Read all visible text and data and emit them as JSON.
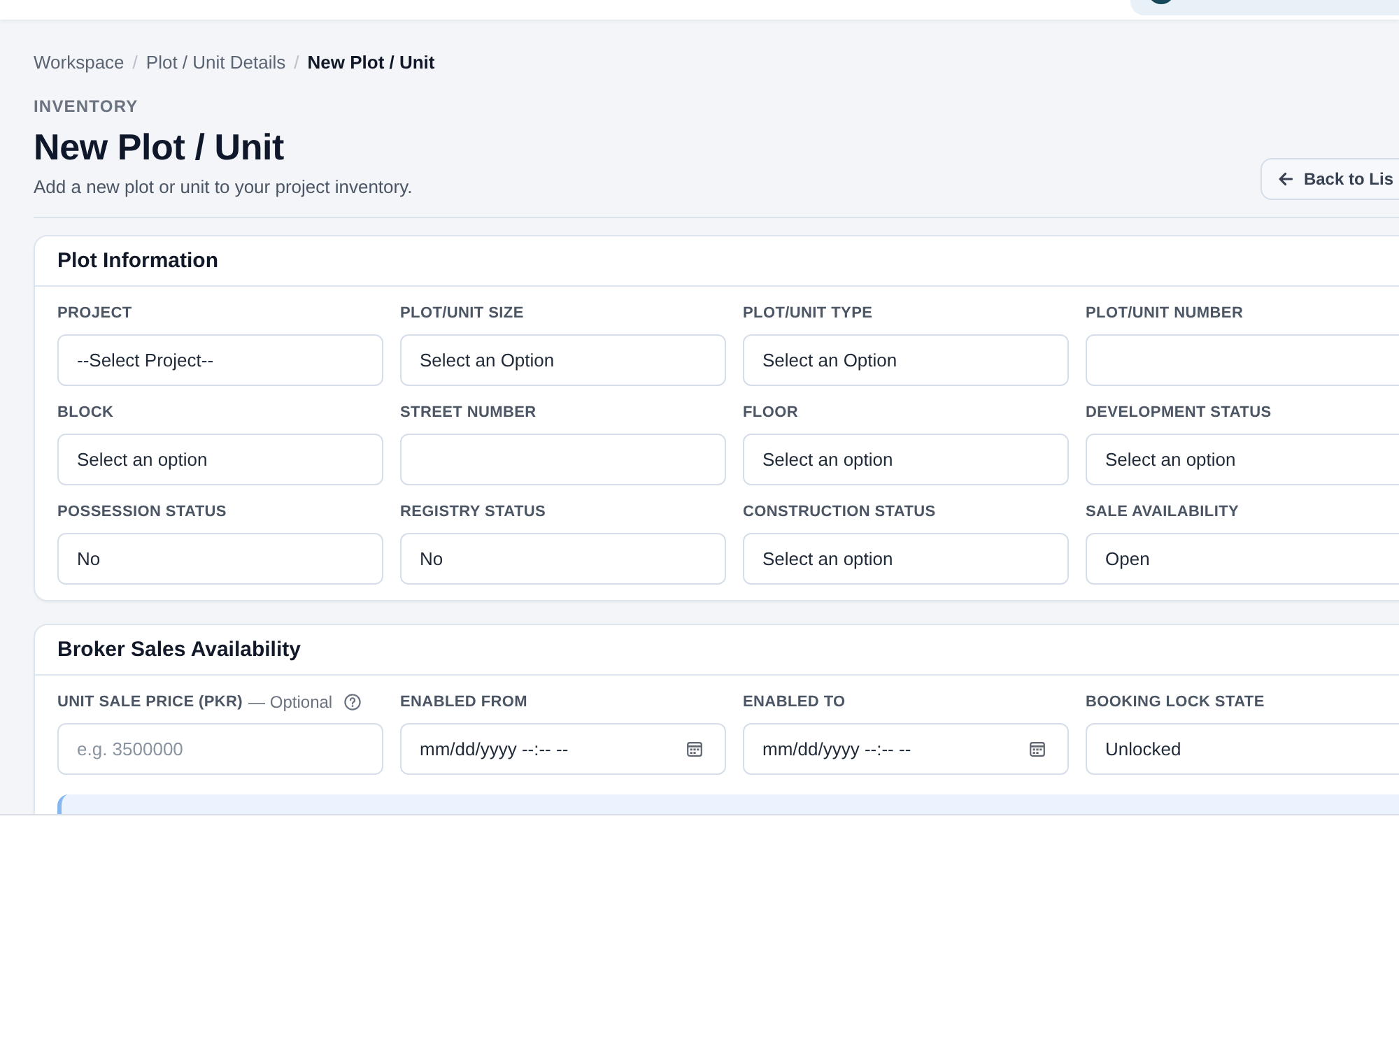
{
  "breadcrumb": [
    {
      "kind": "link",
      "label": "Workspace"
    },
    {
      "kind": "separator",
      "label": "/"
    },
    {
      "kind": "link",
      "label": "Plot / Unit Details"
    },
    {
      "kind": "separator",
      "label": "/"
    },
    {
      "kind": "current",
      "label": "New Plot / Unit"
    }
  ],
  "page_header": {
    "eyebrow": "INVENTORY",
    "title": "New Plot / Unit",
    "subtitle": "Add a new plot or unit to your project inventory.",
    "back_button": "Back to Lis"
  },
  "sections": [
    {
      "title": "Plot Information",
      "fields": [
        {
          "label": "PROJECT",
          "kind": "select",
          "value": "--Select Project--"
        },
        {
          "label": "PLOT/UNIT SIZE",
          "kind": "select",
          "value": "Select an Option"
        },
        {
          "label": "PLOT/UNIT TYPE",
          "kind": "select",
          "value": "Select an Option"
        },
        {
          "label": "PLOT/UNIT NUMBER",
          "kind": "text"
        },
        {
          "label": "BLOCK",
          "kind": "select",
          "value": "Select an option"
        },
        {
          "label": "STREET NUMBER",
          "kind": "text"
        },
        {
          "label": "FLOOR",
          "kind": "select",
          "value": "Select an option"
        },
        {
          "label": "DEVELOPMENT STATUS",
          "kind": "select",
          "value": "Select an option"
        },
        {
          "label": "POSSESSION STATUS",
          "kind": "select",
          "value": "No"
        },
        {
          "label": "REGISTRY STATUS",
          "kind": "select",
          "value": "No"
        },
        {
          "label": "CONSTRUCTION STATUS",
          "kind": "select",
          "value": "Select an option"
        },
        {
          "label": "SALE AVAILABILITY",
          "kind": "select",
          "value": "Open"
        }
      ]
    },
    {
      "title": "Broker Sales Availability",
      "fields": [
        {
          "label": "UNIT SALE PRICE (PKR)",
          "hint": "— Optional",
          "help": true,
          "kind": "text",
          "placeholder": "e.g. 3500000"
        },
        {
          "label": "ENABLED FROM",
          "kind": "datetime",
          "value": "mm/dd/yyyy --:-- --"
        },
        {
          "label": "ENABLED TO",
          "kind": "datetime",
          "value": "mm/dd/yyyy --:-- --"
        },
        {
          "label": "BOOKING LOCK STATE",
          "kind": "select",
          "value": "Unlocked"
        }
      ],
      "notice": {
        "kind": "info"
      }
    }
  ]
}
